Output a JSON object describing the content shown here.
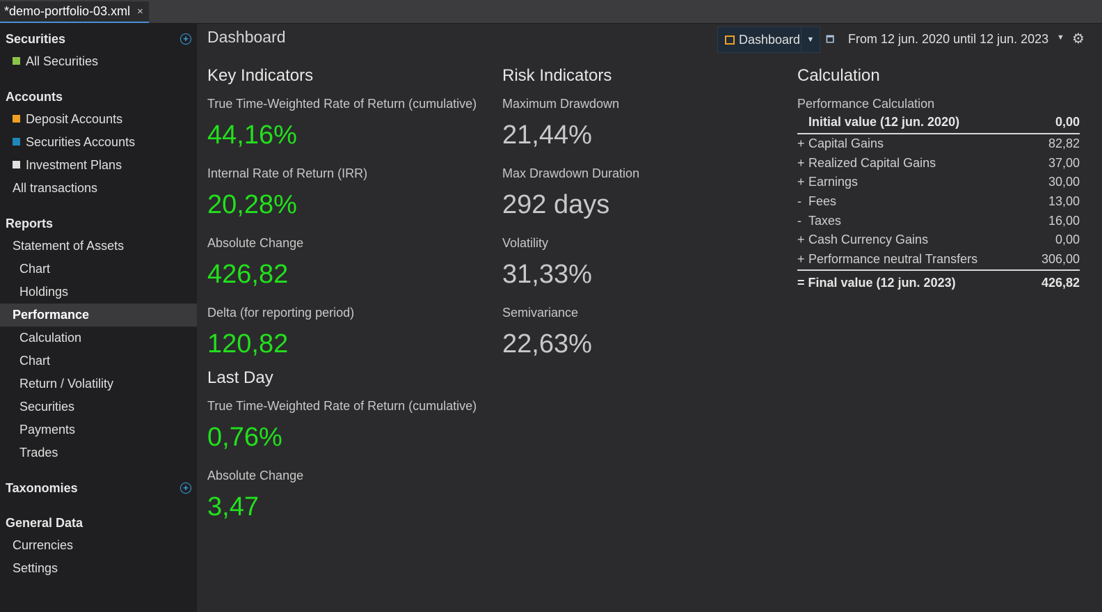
{
  "tab": {
    "title": "*demo-portfolio-03.xml",
    "close": "×"
  },
  "sidebar": {
    "securities": {
      "header": "Securities",
      "items": [
        {
          "label": "All Securities",
          "color": "#8bc34a"
        }
      ]
    },
    "accounts": {
      "header": "Accounts",
      "items": [
        {
          "label": "Deposit Accounts",
          "color": "#f0a020"
        },
        {
          "label": "Securities Accounts",
          "color": "#1e88b8"
        },
        {
          "label": "Investment Plans",
          "color": "#e0e0e0"
        },
        {
          "label": "All transactions"
        }
      ]
    },
    "reports": {
      "header": "Reports",
      "items": [
        {
          "label": "Statement of Assets"
        },
        {
          "label": "Chart"
        },
        {
          "label": "Holdings"
        },
        {
          "label": "Performance",
          "active": true
        },
        {
          "label": "Calculation"
        },
        {
          "label": "Chart"
        },
        {
          "label": "Return / Volatility"
        },
        {
          "label": "Securities"
        },
        {
          "label": "Payments"
        },
        {
          "label": "Trades"
        }
      ]
    },
    "taxonomies": {
      "header": "Taxonomies"
    },
    "general": {
      "header": "General Data",
      "items": [
        {
          "label": "Currencies"
        },
        {
          "label": "Settings"
        }
      ]
    },
    "add_icon": "plus-circle-icon"
  },
  "main": {
    "title": "Dashboard",
    "toolbar": {
      "dashboard_label": "Dashboard",
      "period": "From 12 jun. 2020 until 12 jun. 2023"
    },
    "key_indicators": {
      "heading": "Key Indicators",
      "metrics": [
        {
          "label": "True Time-Weighted Rate of Return (cumulative)",
          "value": "44,16%"
        },
        {
          "label": "Internal Rate of Return (IRR)",
          "value": "20,28%"
        },
        {
          "label": "Absolute Change",
          "value": "426,82"
        },
        {
          "label": "Delta (for reporting period)",
          "value": "120,82"
        }
      ]
    },
    "last_day": {
      "heading": "Last Day",
      "metrics": [
        {
          "label": "True Time-Weighted Rate of Return (cumulative)",
          "value": "0,76%"
        },
        {
          "label": "Absolute Change",
          "value": "3,47"
        }
      ]
    },
    "risk_indicators": {
      "heading": "Risk Indicators",
      "metrics": [
        {
          "label": "Maximum Drawdown",
          "value": "21,44%"
        },
        {
          "label": "Max Drawdown Duration",
          "value": "292 days"
        },
        {
          "label": "Volatility",
          "value": "31,33%"
        },
        {
          "label": "Semivariance",
          "value": "22,63%"
        }
      ]
    },
    "calculation": {
      "heading": "Calculation",
      "subtitle": "Performance Calculation",
      "initial": {
        "label": "Initial value (12 jun. 2020)",
        "value": "0,00"
      },
      "rows": [
        {
          "sign": "+",
          "label": "Capital Gains",
          "value": "82,82"
        },
        {
          "sign": "+",
          "label": "Realized Capital Gains",
          "value": "37,00"
        },
        {
          "sign": "+",
          "label": "Earnings",
          "value": "30,00"
        },
        {
          "sign": "-",
          "label": "Fees",
          "value": "13,00"
        },
        {
          "sign": "-",
          "label": "Taxes",
          "value": "16,00"
        },
        {
          "sign": "+",
          "label": "Cash Currency Gains",
          "value": "0,00"
        },
        {
          "sign": "+",
          "label": "Performance neutral Transfers",
          "value": "306,00"
        }
      ],
      "final": {
        "label": "= Final value (12 jun. 2023)",
        "value": "426,82"
      }
    }
  },
  "colors": {
    "positive": "#22e01c",
    "neutral": "#c8c8c8",
    "accent": "#3aa0e0",
    "sidebar_bg": "#1f1f21",
    "main_bg": "#2b2b2d"
  }
}
